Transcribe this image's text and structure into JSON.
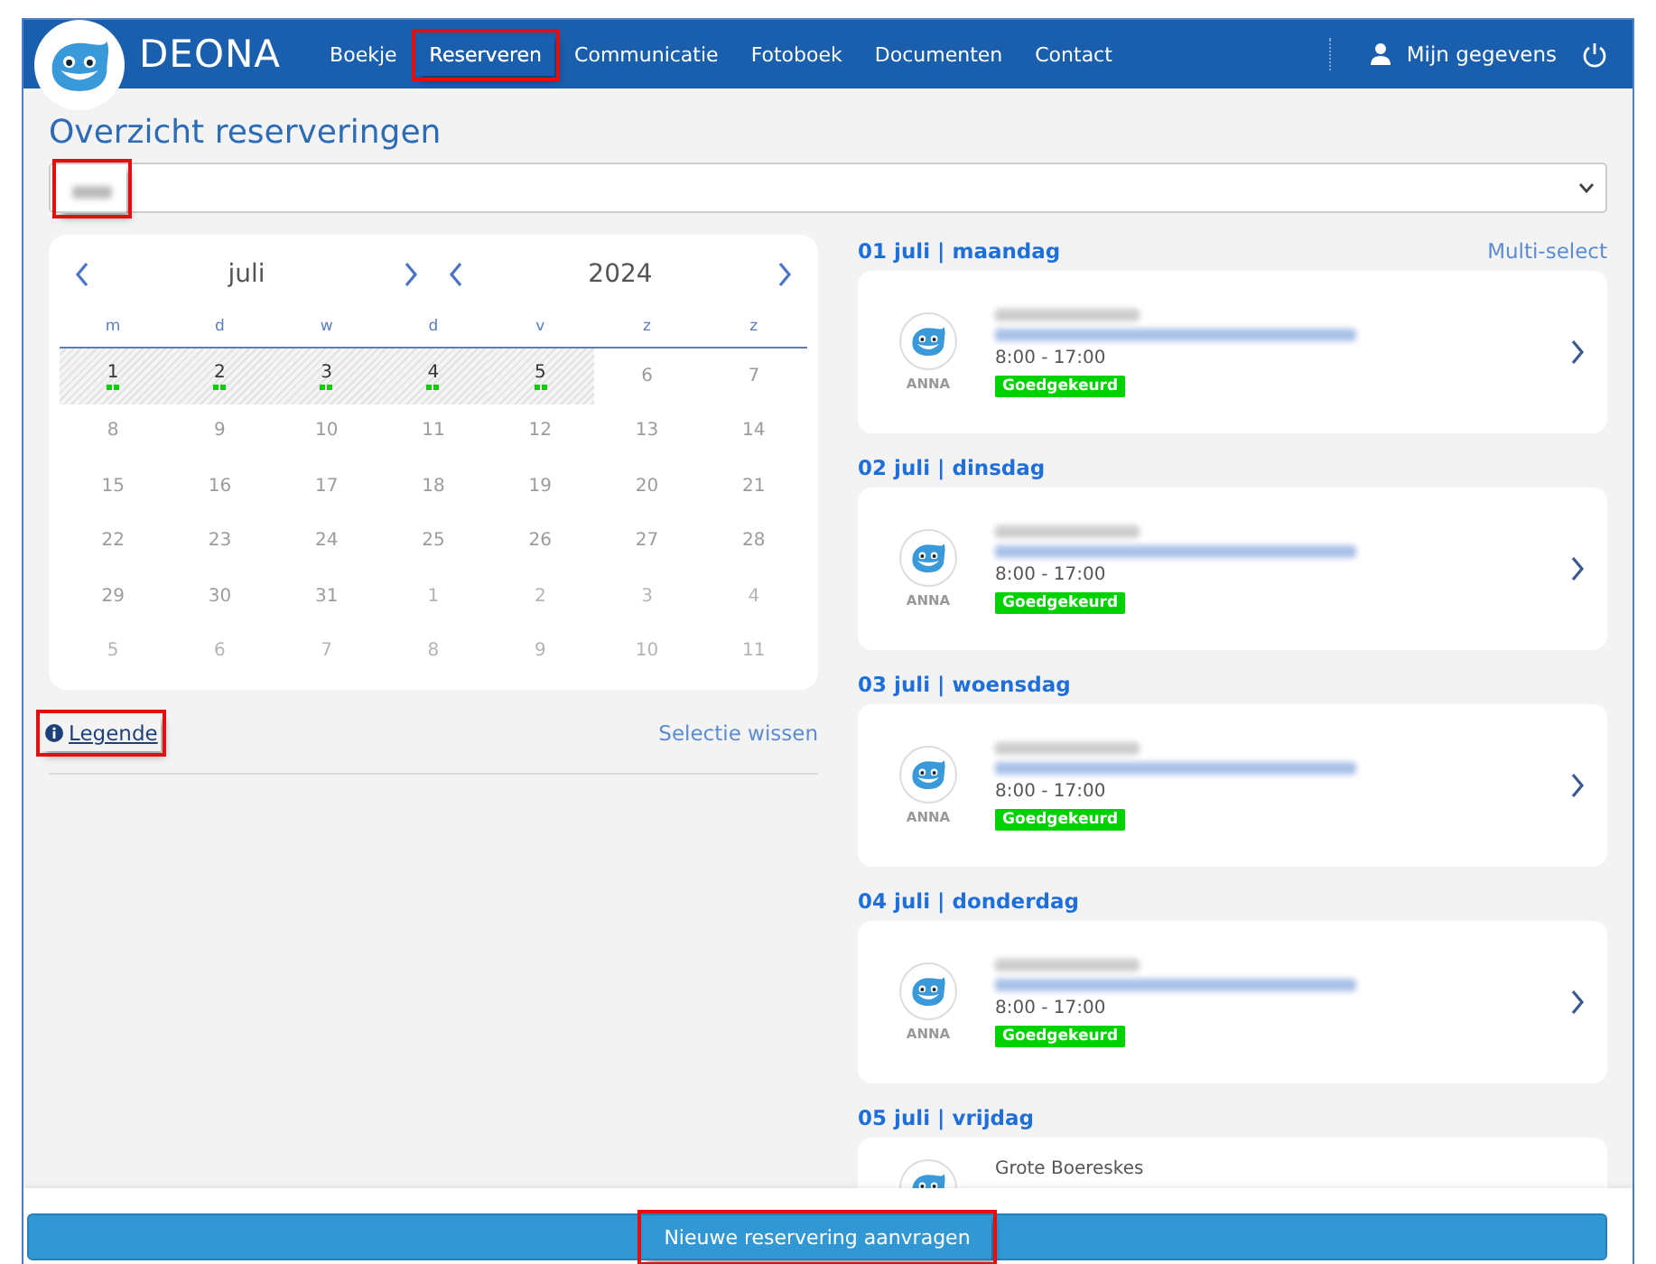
{
  "brand": {
    "name": "DEONA"
  },
  "nav": [
    {
      "label": "Boekje",
      "selected": false,
      "highlighted": false
    },
    {
      "label": "Reserveren",
      "selected": true,
      "highlighted": true
    },
    {
      "label": "Communicatie",
      "selected": false,
      "highlighted": false
    },
    {
      "label": "Fotoboek",
      "selected": false,
      "highlighted": false
    },
    {
      "label": "Documenten",
      "selected": false,
      "highlighted": false
    },
    {
      "label": "Contact",
      "selected": false,
      "highlighted": false
    }
  ],
  "account": {
    "label": "Mijn gegevens"
  },
  "page_title": "Overzicht reserveringen",
  "child_select": {
    "highlighted": true
  },
  "calendar": {
    "month": "juli",
    "year": "2024",
    "weekdays": [
      "m",
      "d",
      "w",
      "d",
      "v",
      "z",
      "z"
    ],
    "days": [
      {
        "label": "1",
        "available": true,
        "outside": false
      },
      {
        "label": "2",
        "available": true,
        "outside": false
      },
      {
        "label": "3",
        "available": true,
        "outside": false
      },
      {
        "label": "4",
        "available": true,
        "outside": false
      },
      {
        "label": "5",
        "available": true,
        "outside": false
      },
      {
        "label": "6",
        "available": false,
        "outside": false
      },
      {
        "label": "7",
        "available": false,
        "outside": false
      },
      {
        "label": "8",
        "available": false,
        "outside": false
      },
      {
        "label": "9",
        "available": false,
        "outside": false
      },
      {
        "label": "10",
        "available": false,
        "outside": false
      },
      {
        "label": "11",
        "available": false,
        "outside": false
      },
      {
        "label": "12",
        "available": false,
        "outside": false
      },
      {
        "label": "13",
        "available": false,
        "outside": false
      },
      {
        "label": "14",
        "available": false,
        "outside": false
      },
      {
        "label": "15",
        "available": false,
        "outside": false
      },
      {
        "label": "16",
        "available": false,
        "outside": false
      },
      {
        "label": "17",
        "available": false,
        "outside": false
      },
      {
        "label": "18",
        "available": false,
        "outside": false
      },
      {
        "label": "19",
        "available": false,
        "outside": false
      },
      {
        "label": "20",
        "available": false,
        "outside": false
      },
      {
        "label": "21",
        "available": false,
        "outside": false
      },
      {
        "label": "22",
        "available": false,
        "outside": false
      },
      {
        "label": "23",
        "available": false,
        "outside": false
      },
      {
        "label": "24",
        "available": false,
        "outside": false
      },
      {
        "label": "25",
        "available": false,
        "outside": false
      },
      {
        "label": "26",
        "available": false,
        "outside": false
      },
      {
        "label": "27",
        "available": false,
        "outside": false
      },
      {
        "label": "28",
        "available": false,
        "outside": false
      },
      {
        "label": "29",
        "available": false,
        "outside": false
      },
      {
        "label": "30",
        "available": false,
        "outside": false
      },
      {
        "label": "31",
        "available": false,
        "outside": false
      },
      {
        "label": "1",
        "available": false,
        "outside": true
      },
      {
        "label": "2",
        "available": false,
        "outside": true
      },
      {
        "label": "3",
        "available": false,
        "outside": true
      },
      {
        "label": "4",
        "available": false,
        "outside": true
      },
      {
        "label": "5",
        "available": false,
        "outside": true
      },
      {
        "label": "6",
        "available": false,
        "outside": true
      },
      {
        "label": "7",
        "available": false,
        "outside": true
      },
      {
        "label": "8",
        "available": false,
        "outside": true
      },
      {
        "label": "9",
        "available": false,
        "outside": true
      },
      {
        "label": "10",
        "available": false,
        "outside": true
      },
      {
        "label": "11",
        "available": false,
        "outside": true
      }
    ]
  },
  "legend_link": {
    "label": "Legende",
    "highlighted": true
  },
  "clear_selection": "Selectie wissen",
  "multi_select": "Multi-select",
  "reservations": [
    {
      "date": "01 juli | maandag",
      "child": "ANNA",
      "time": "8:00 - 17:00",
      "status": {
        "label": "Goedgekeurd",
        "color": "#00d100"
      }
    },
    {
      "date": "02 juli | dinsdag",
      "child": "ANNA",
      "time": "8:00 - 17:00",
      "status": {
        "label": "Goedgekeurd",
        "color": "#00d100"
      }
    },
    {
      "date": "03 juli | woensdag",
      "child": "ANNA",
      "time": "8:00 - 17:00",
      "status": {
        "label": "Goedgekeurd",
        "color": "#00d100"
      }
    },
    {
      "date": "04 juli | donderdag",
      "child": "ANNA",
      "time": "8:00 - 17:00",
      "status": {
        "label": "Goedgekeurd",
        "color": "#00d100"
      }
    },
    {
      "date": "05 juli | vrijdag",
      "title": "Grote Boereskes"
    }
  ],
  "new_button": {
    "label": "Nieuwe reservering aanvragen",
    "highlighted": true
  }
}
